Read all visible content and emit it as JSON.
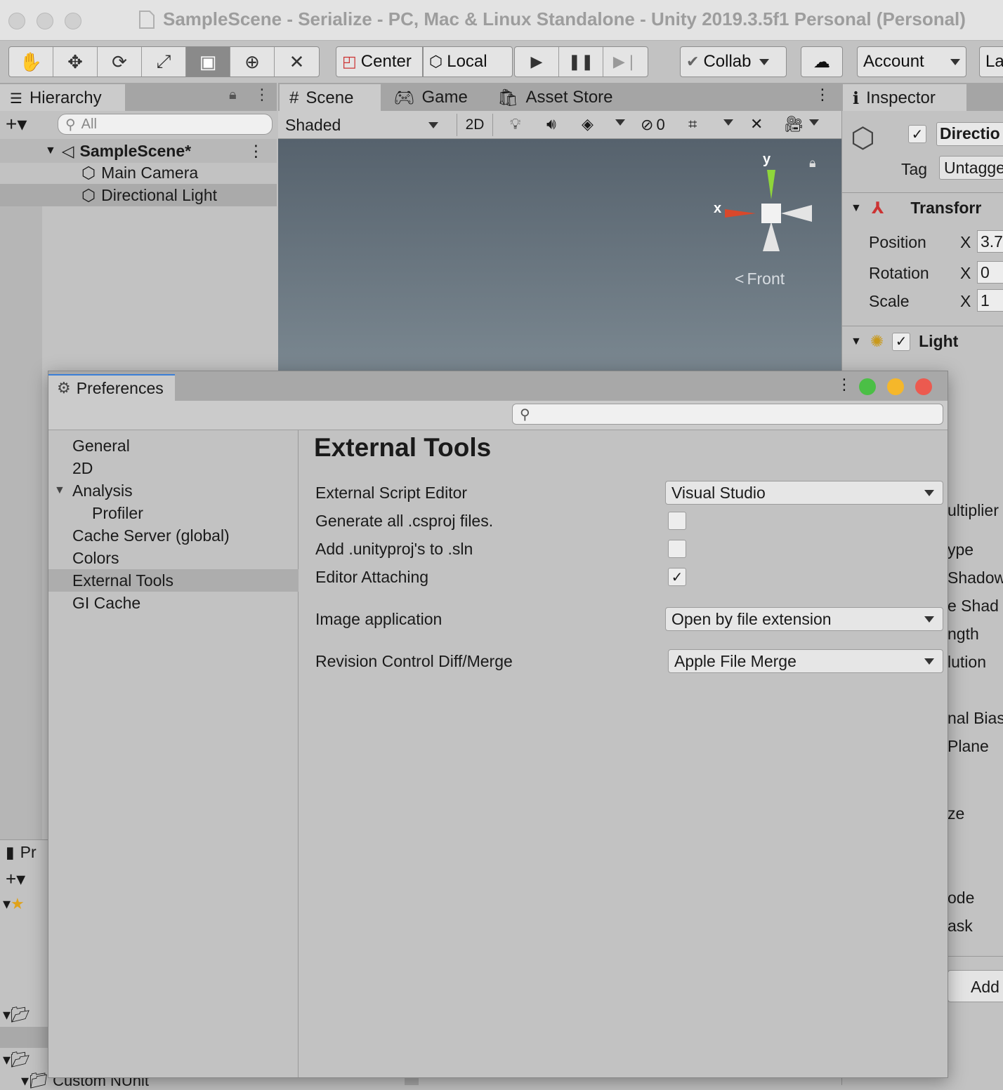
{
  "window": {
    "title": "SampleScene - Serialize - PC, Mac & Linux Standalone - Unity 2019.3.5f1 Personal (Personal)"
  },
  "toolbar": {
    "pivot_label": "Center",
    "space_label": "Local",
    "collab_label": "Collab",
    "account_label": "Account",
    "layers_label": "La"
  },
  "hierarchy": {
    "tab_label": "Hierarchy",
    "search_placeholder": "All",
    "scene_name": "SampleScene*",
    "items": [
      {
        "label": "Main Camera"
      },
      {
        "label": "Directional Light"
      }
    ]
  },
  "project": {
    "tab_label": "Pr",
    "folder_label": "Custom NUnit"
  },
  "scene_view": {
    "tabs": [
      {
        "label": "Scene"
      },
      {
        "label": "Game"
      },
      {
        "label": "Asset Store"
      }
    ],
    "shading_mode": "Shaded",
    "mode_2d": "2D",
    "hidden_count": "0",
    "gizmo_y": "y",
    "gizmo_x": "x",
    "view_label": "Front",
    "colors": {
      "axis_x": "#d9482b",
      "axis_y": "#8fd63a"
    }
  },
  "inspector": {
    "tab_label": "Inspector",
    "object_name": "Directio",
    "tag_label": "Tag",
    "tag_value": "Untagge",
    "transform_label": "Transforr",
    "rows": [
      {
        "label": "Position",
        "axis": "X",
        "value": "3.7"
      },
      {
        "label": "Rotation",
        "axis": "X",
        "value": "0"
      },
      {
        "label": "Scale",
        "axis": "X",
        "value": "1"
      }
    ],
    "light_label": "Light",
    "partial_labels": [
      "ultiplier",
      "ype",
      "Shadow",
      "e Shad",
      "ngth",
      "lution",
      "nal Bias",
      "Plane",
      "ze",
      "ode",
      "ask"
    ],
    "add_component": "Add"
  },
  "preferences": {
    "title": "Preferences",
    "search_placeholder": "",
    "sidebar": [
      {
        "label": "General",
        "indent": 0
      },
      {
        "label": "2D",
        "indent": 0
      },
      {
        "label": "Analysis",
        "indent": 0,
        "expanded": true
      },
      {
        "label": "Profiler",
        "indent": 1
      },
      {
        "label": "Cache Server (global)",
        "indent": 0
      },
      {
        "label": "Colors",
        "indent": 0
      },
      {
        "label": "External Tools",
        "indent": 0,
        "selected": true
      },
      {
        "label": "GI Cache",
        "indent": 0
      }
    ],
    "section_title": "External Tools",
    "settings": {
      "script_editor_label": "External Script Editor",
      "script_editor_value": "Visual Studio",
      "csproj_label": "Generate all .csproj files.",
      "csproj_checked": false,
      "unityproj_label": "Add .unityproj's to .sln",
      "unityproj_checked": false,
      "attaching_label": "Editor Attaching",
      "attaching_checked": true,
      "image_app_label": "Image application",
      "image_app_value": "Open by file extension",
      "diff_label": "Revision Control Diff/Merge",
      "diff_value": "Apple File Merge"
    },
    "window_buttons": {
      "maximize": "#4bbf46",
      "minimize": "#f5b72a",
      "close": "#ec5a4f"
    }
  }
}
